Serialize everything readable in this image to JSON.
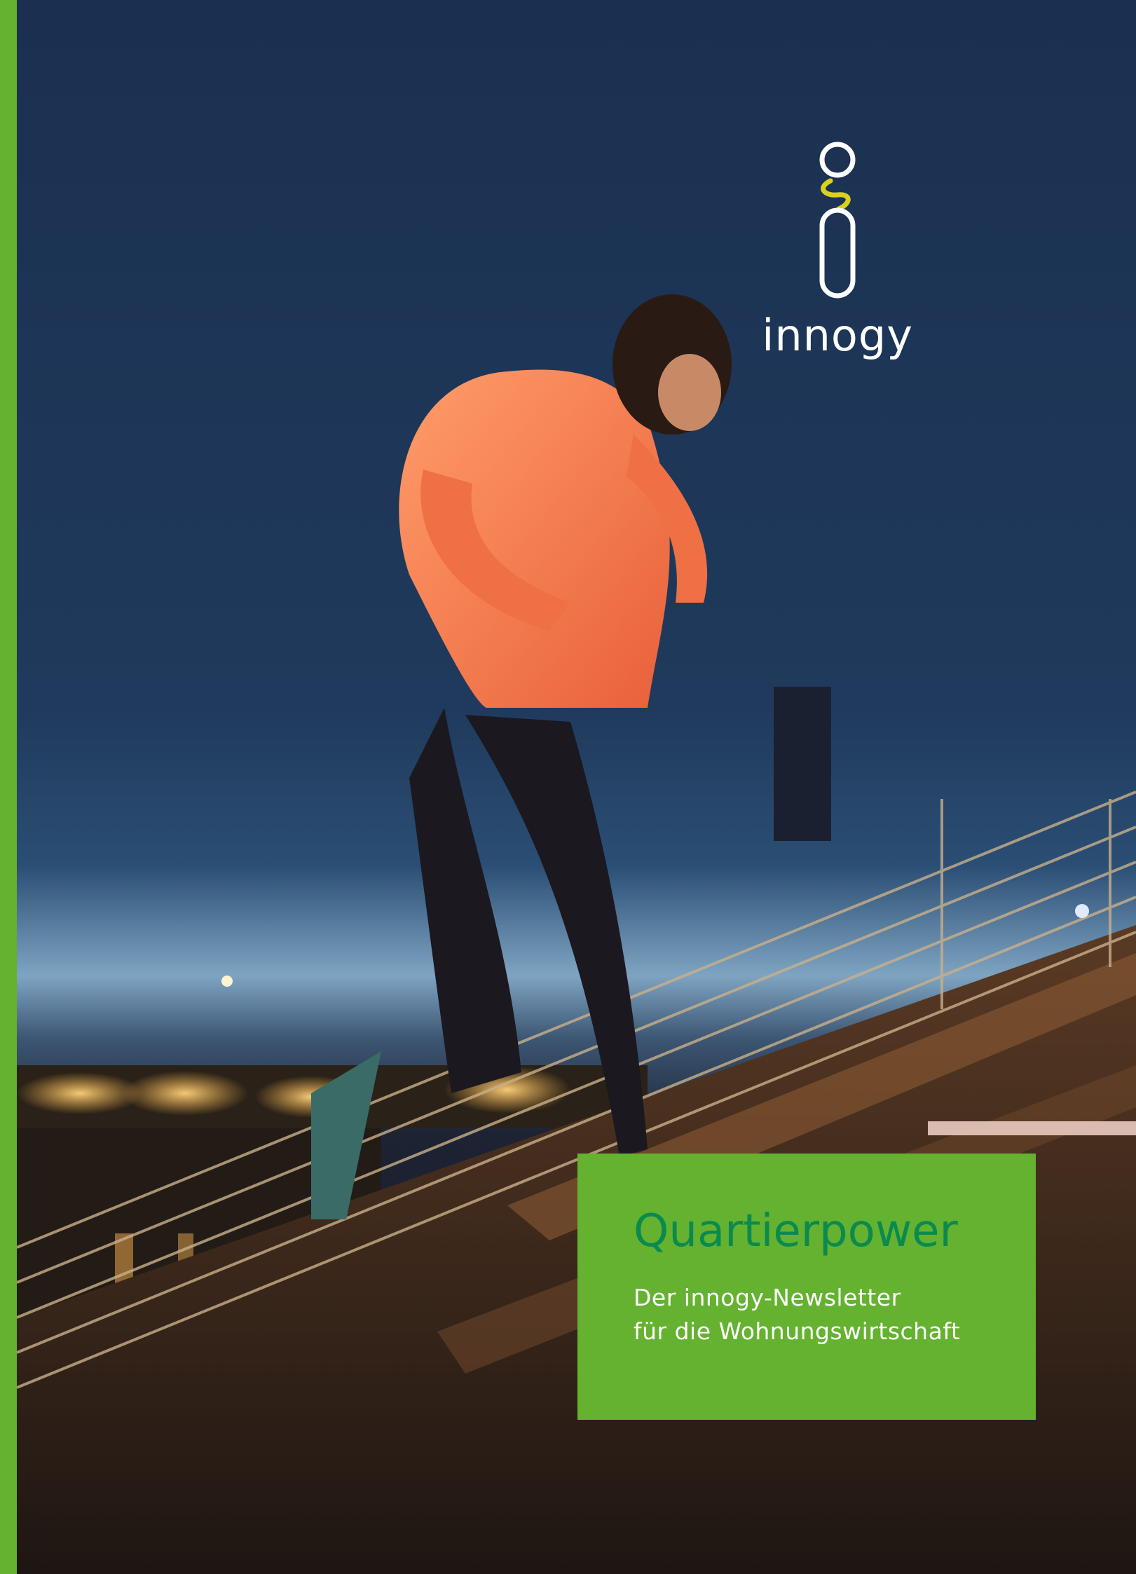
{
  "logo": {
    "wordmark": "innogy"
  },
  "title_box": {
    "title": "Quartierpower",
    "subtitle_line1": "Der innogy-Newsletter",
    "subtitle_line2": "für die Wohnungswirtschaft"
  },
  "colors": {
    "brand_green": "#64b22f",
    "title_green": "#0b8a4f",
    "logo_accent_yellow": "#d8d21c",
    "sky_blue": "#1e3552"
  }
}
